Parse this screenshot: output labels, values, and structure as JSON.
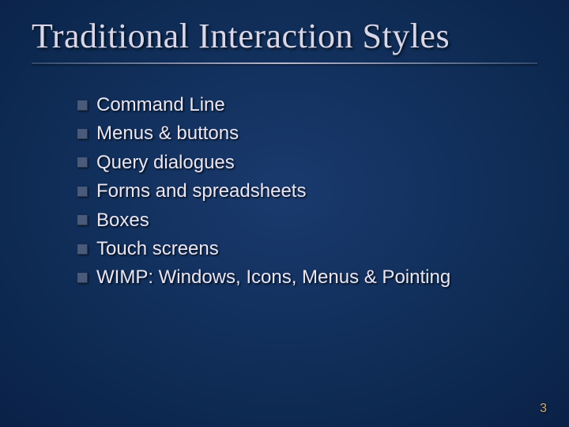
{
  "slide": {
    "title": "Traditional Interaction Styles",
    "bullets": [
      "Command Line",
      "Menus & buttons",
      "Query dialogues",
      "Forms and spreadsheets",
      "Boxes",
      "Touch screens",
      "WIMP: Windows, Icons, Menus & Pointing"
    ],
    "page_number": "3"
  }
}
